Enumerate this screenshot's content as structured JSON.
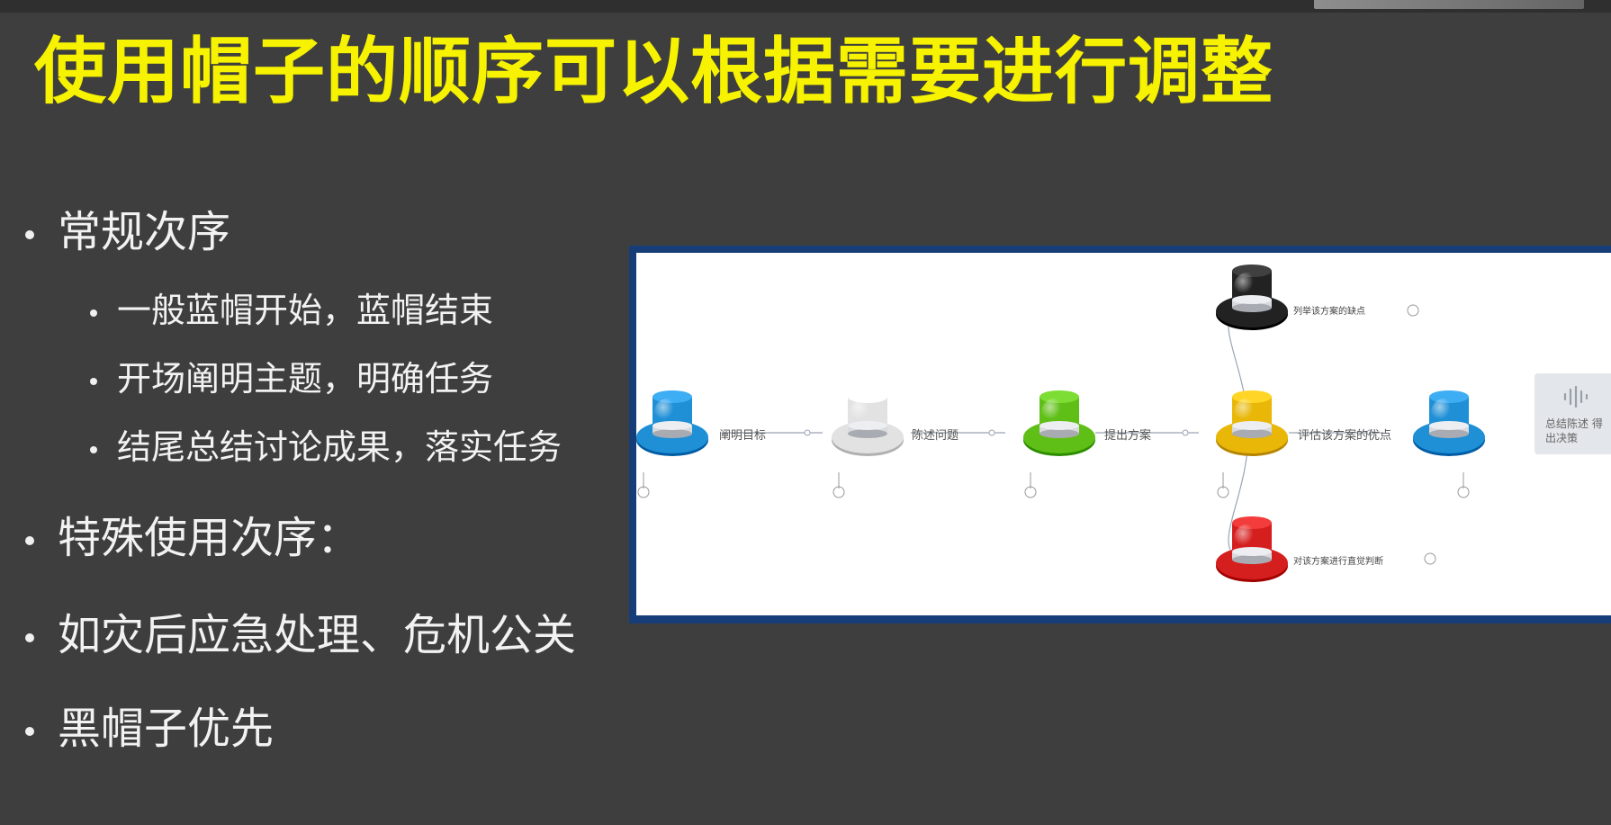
{
  "slide": {
    "title": "使用帽子的顺序可以根据需要进行调整",
    "bullets": [
      {
        "level": 1,
        "text": "常规次序"
      },
      {
        "level": 2,
        "text": "一般蓝帽开始，蓝帽结束"
      },
      {
        "level": 2,
        "text": "开场阐明主题，明确任务"
      },
      {
        "level": 2,
        "text": "结尾总结讨论成果，落实任务"
      },
      {
        "level": 1,
        "text": "特殊使用次序："
      },
      {
        "level": 1,
        "text": "如灾后应急处理、危机公关"
      },
      {
        "level": 1,
        "text": "黑帽子优先"
      }
    ]
  },
  "diagram": {
    "main_flow": [
      {
        "hat": "blue-hat-icon",
        "color": "#1f8fd6",
        "label": "阐明目标"
      },
      {
        "hat": "white-hat-icon",
        "color": "#e2e2e2",
        "label": "陈述问题"
      },
      {
        "hat": "green-hat-icon",
        "color": "#5fbf16",
        "label": "提出方案"
      },
      {
        "hat": "yellow-hat-icon",
        "color": "#e8b708",
        "label": "评估该方案的优点"
      },
      {
        "hat": "blue-hat-icon",
        "color": "#1f8fd6",
        "label": "总结陈述 得出决策"
      }
    ],
    "branch_top": {
      "hat": "black-hat-icon",
      "color": "#222222",
      "label": "列举该方案的缺点"
    },
    "branch_bottom": {
      "hat": "red-hat-icon",
      "color": "#d51f1f",
      "label": "对该方案进行直觉判断"
    }
  },
  "side_panel": {
    "icon": "audio-wave-icon",
    "text": "总结陈述 得出决策"
  }
}
